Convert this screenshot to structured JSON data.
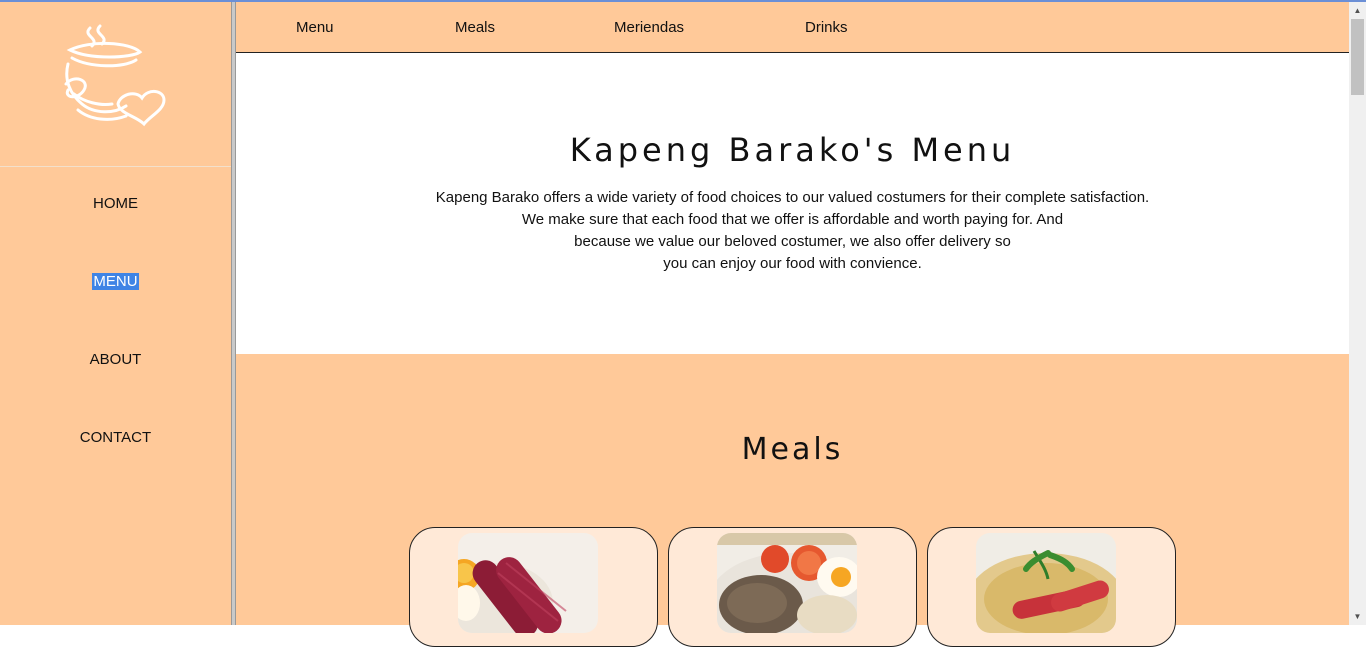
{
  "sidebar": {
    "logo_icon": "coffee-cup-heart-logo",
    "items": [
      {
        "label": "HOME",
        "selected": false
      },
      {
        "label": "MENU",
        "selected": true
      },
      {
        "label": "ABOUT",
        "selected": false
      },
      {
        "label": "CONTACT",
        "selected": false
      }
    ]
  },
  "topnav": {
    "items": [
      "Menu",
      "Meals",
      "Meriendas",
      "Drinks"
    ]
  },
  "hero": {
    "title": "Kapeng Barako's Menu",
    "lines": [
      "Kapeng Barako offers a wide variety of food choices to our valued costumers for their complete satisfaction.",
      "We make sure that each food that we offer is affordable and worth paying for. And",
      "because we value our beloved costumer, we also offer delivery so",
      "you can enjoy our food with convience."
    ]
  },
  "meals": {
    "title": "Meals",
    "cards": [
      {
        "image": "longganisa-sinangag-photo"
      },
      {
        "image": "tapsilog-photo"
      },
      {
        "image": "longsilog-garlic-rice-photo"
      }
    ]
  },
  "colors": {
    "peach": "#ffc999",
    "card_bg": "#ffe9d7",
    "selection": "#3f84e5"
  }
}
